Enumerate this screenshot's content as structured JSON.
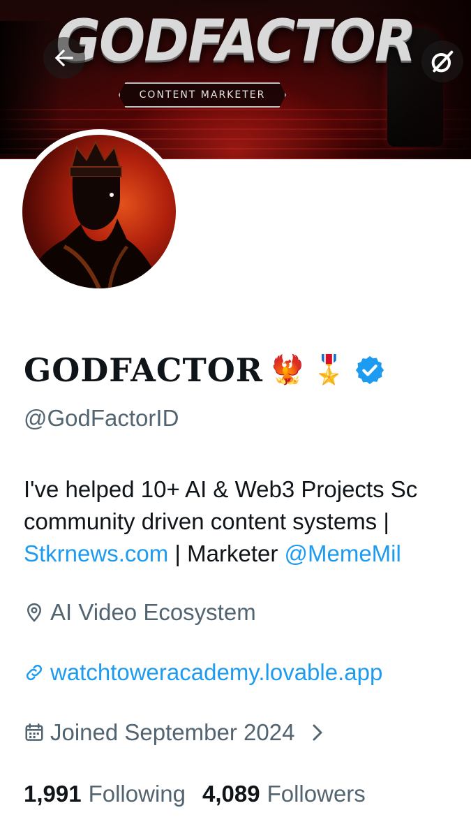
{
  "banner": {
    "title": "GODFACTOR",
    "subtitle": "CONTENT MARKETER"
  },
  "toolbar": {
    "back_icon": "arrow-left-icon",
    "tools_icon": "grok-icon"
  },
  "profile": {
    "display_name": "GODFACTOR",
    "emoji_1": "🐦‍🔥",
    "emoji_2": "🎖️",
    "verified_icon": "verified-badge-icon",
    "handle": "@GodFactorID",
    "bio": {
      "line1": "I've helped 10+ AI & Web3 Projects Sc",
      "line2": "community driven content systems |",
      "line3_link1": "Stkrnews.com",
      "line3_text": " | Marketer ",
      "line3_link2": "@MemeMil"
    },
    "location": "AI Video Ecosystem",
    "website": "watchtoweracademy.lovable.app",
    "joined": "Joined September 2024",
    "following_count": "1,991",
    "following_label": "Following",
    "followers_count": "4,089",
    "followers_label": "Followers"
  },
  "colors": {
    "link": "#1d9bf0",
    "secondary_text": "#536471",
    "primary_text": "#0f1419",
    "verified": "#1d9bf0"
  }
}
